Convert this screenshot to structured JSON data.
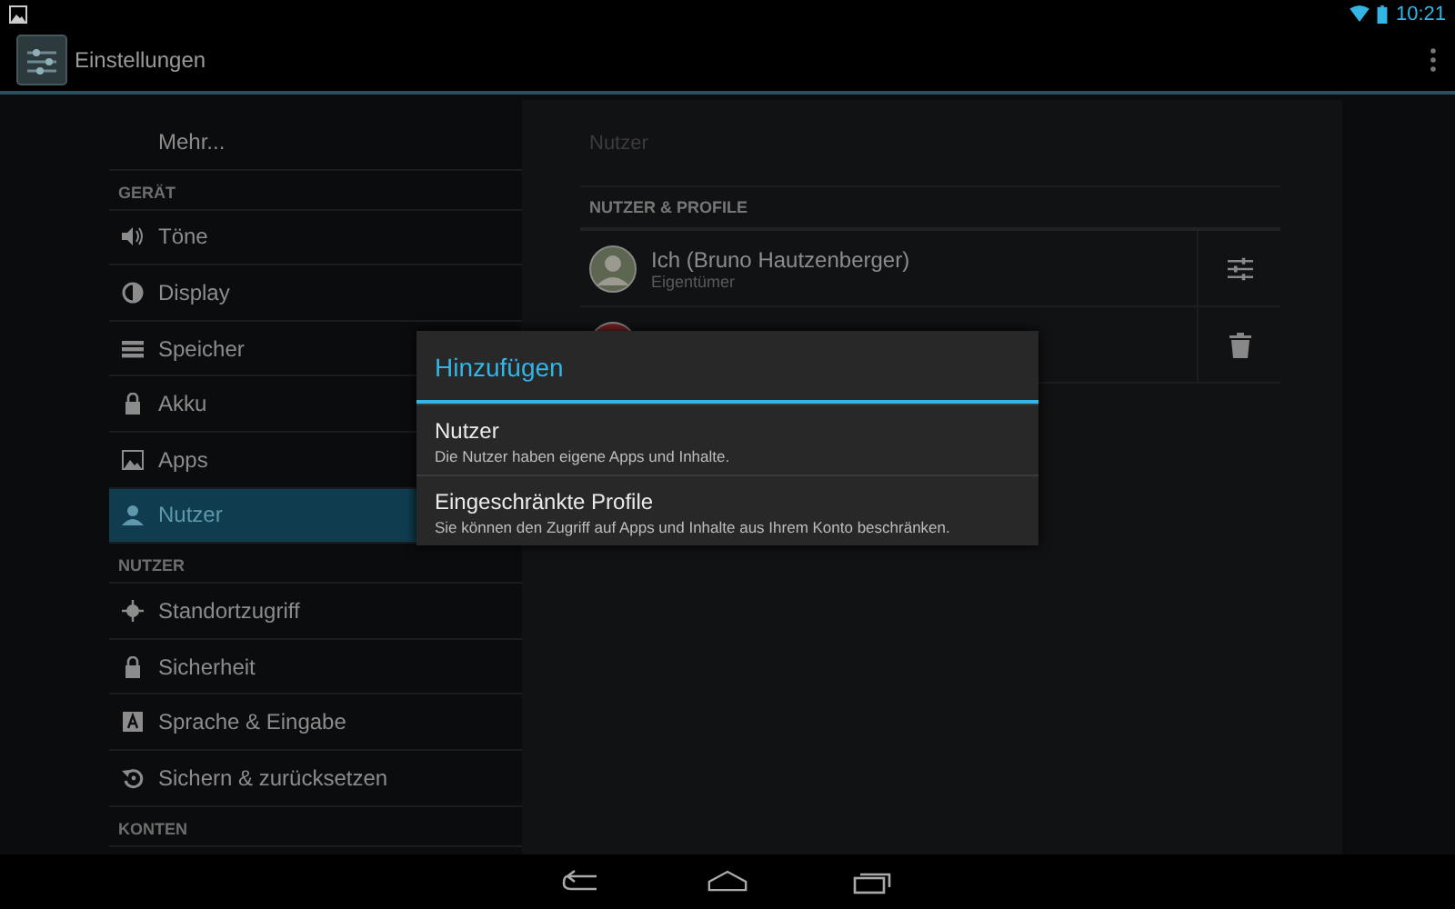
{
  "status_bar": {
    "time": "10:21"
  },
  "action_bar": {
    "title": "Einstellungen"
  },
  "sidebar": {
    "sections": [
      {
        "items": [
          {
            "label": "Mehr...",
            "selected": false
          }
        ]
      },
      {
        "header": "GERÄT",
        "items": [
          {
            "label": "Töne",
            "selected": false
          },
          {
            "label": "Display",
            "selected": false
          },
          {
            "label": "Speicher",
            "selected": false
          },
          {
            "label": "Akku",
            "selected": false
          },
          {
            "label": "Apps",
            "selected": false
          },
          {
            "label": "Nutzer",
            "selected": true
          }
        ]
      },
      {
        "header": "NUTZER",
        "items": [
          {
            "label": "Standortzugriff",
            "selected": false
          },
          {
            "label": "Sicherheit",
            "selected": false
          },
          {
            "label": "Sprache & Eingabe",
            "selected": false
          },
          {
            "label": "Sichern & zurücksetzen",
            "selected": false
          }
        ]
      },
      {
        "header": "KONTEN"
      }
    ]
  },
  "detail": {
    "title": "Nutzer",
    "section_header": "NUTZER & PROFILE",
    "users": [
      {
        "name": "Ich (Bruno Hautzenberger)",
        "subtitle": "Eigentümer",
        "kind": "settings"
      },
      {
        "kind": "delete"
      }
    ]
  },
  "dialog": {
    "title": "Hinzufügen",
    "options": [
      {
        "title": "Nutzer",
        "description": "Die Nutzer haben eigene Apps und Inhalte."
      },
      {
        "title": "Eingeschränkte Profile",
        "description": "Sie können den Zugriff auf Apps und Inhalte aus Ihrem Konto beschränken."
      }
    ]
  }
}
